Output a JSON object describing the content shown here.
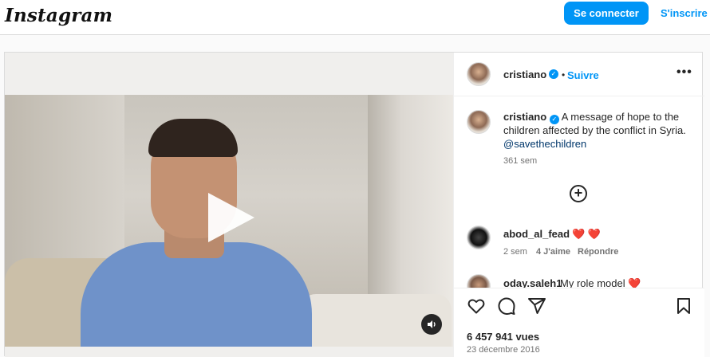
{
  "header": {
    "logo_text": "Instagram",
    "login_label": "Se connecter",
    "signup_label": "S'inscrire"
  },
  "post": {
    "author": "cristiano",
    "dot": "•",
    "follow_label": "Suivre",
    "more_label": "•••",
    "caption_text": "A message of hope to the children affected by the conflict in Syria.",
    "caption_mention": "@savethechildren",
    "caption_age": "361 sem",
    "comments": [
      {
        "user": "abod_al_fead",
        "text": "❤️ ❤️",
        "age": "2 sem",
        "likes": "4 J'aime",
        "reply_label": "Répondre"
      },
      {
        "user": "oday.saleh1",
        "text": "My role model ❤️"
      }
    ],
    "views": "6 457 941 vues",
    "date": "23 décembre 2016"
  },
  "icons": {
    "verified": "verified-badge-icon",
    "add_comment": "plus-circle-icon",
    "like": "heart-icon",
    "comment": "comment-icon",
    "share": "share-icon",
    "save": "bookmark-icon",
    "mute": "speaker-icon",
    "play": "play-icon"
  },
  "colors": {
    "accent": "#0095f6",
    "mention": "#00376b",
    "heart": "#ed4956"
  }
}
